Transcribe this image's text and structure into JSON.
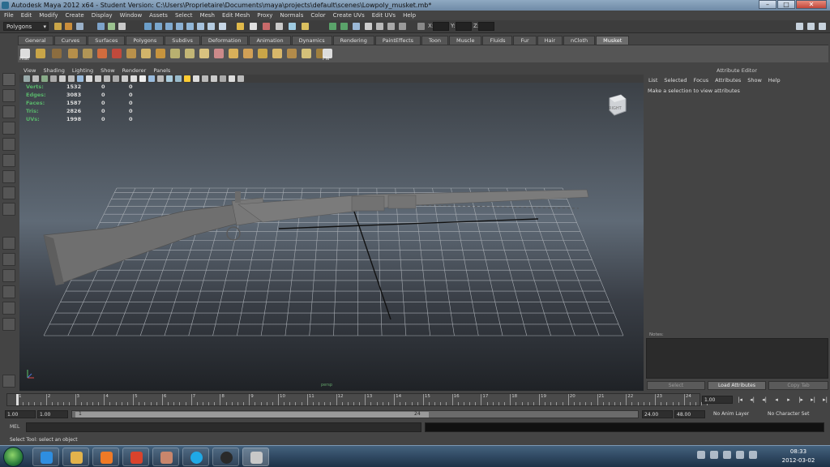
{
  "window": {
    "title": "Autodesk Maya 2012 x64 - Student Version: C:\\Users\\Proprietaire\\Documents\\maya\\projects\\default\\scenes\\Lowpoly_musket.mb*"
  },
  "menubar": [
    "File",
    "Edit",
    "Modify",
    "Create",
    "Display",
    "Window",
    "Assets",
    "Select",
    "Mesh",
    "Edit Mesh",
    "Proxy",
    "Normals",
    "Color",
    "Create UVs",
    "Edit UVs",
    "Help"
  ],
  "statusline": {
    "mode": "Polygons",
    "x_label": "X:",
    "y_label": "Y:",
    "z_label": "Z:"
  },
  "shelf": {
    "tabs": [
      "General",
      "Curves",
      "Surfaces",
      "Polygons",
      "Subdivs",
      "Deformation",
      "Animation",
      "Dynamics",
      "Rendering",
      "PaintEffects",
      "Toon",
      "Muscle",
      "Fluids",
      "Fur",
      "Hair",
      "nCloth",
      "Musket"
    ],
    "active_tab": "Musket",
    "hist_label": "Hist",
    "fn_label": "FN"
  },
  "viewport": {
    "menu": [
      "View",
      "Shading",
      "Lighting",
      "Show",
      "Renderer",
      "Panels"
    ],
    "hud": [
      {
        "label": "Verts:",
        "v1": "1532",
        "v2": "0",
        "v3": "0"
      },
      {
        "label": "Edges:",
        "v1": "3083",
        "v2": "0",
        "v3": "0"
      },
      {
        "label": "Faces:",
        "v1": "1587",
        "v2": "0",
        "v3": "0"
      },
      {
        "label": "Tris:",
        "v1": "2826",
        "v2": "0",
        "v3": "0"
      },
      {
        "label": "UVs:",
        "v1": "1998",
        "v2": "0",
        "v3": "0"
      }
    ],
    "viewcube_label": "RIGHT",
    "camera_label": "persp"
  },
  "attribute_editor": {
    "title": "Attribute Editor",
    "menu": [
      "List",
      "Selected",
      "Focus",
      "Attributes",
      "Show",
      "Help"
    ],
    "message": "Make a selection to view attributes",
    "notes_label": "Notes:",
    "buttons": {
      "select": "Select",
      "load": "Load Attributes",
      "copy": "Copy Tab"
    }
  },
  "timeslider": {
    "ticks": [
      "1",
      "2",
      "3",
      "4",
      "5",
      "6",
      "7",
      "8",
      "9",
      "10",
      "11",
      "12",
      "13",
      "14",
      "15",
      "16",
      "17",
      "18",
      "19",
      "20",
      "21",
      "22",
      "23",
      "24"
    ],
    "current_frame": "1.00"
  },
  "rangeslider": {
    "start": "1.00",
    "start2": "1.00",
    "bar_start": "1",
    "bar_end": "24",
    "end": "24.00",
    "end2": "48.00",
    "anim_layer": "No Anim Layer",
    "char_set": "No Character Set"
  },
  "command": {
    "mel_label": "MEL",
    "help_text": "Select Tool: select an object"
  },
  "taskbar": {
    "time": "08:33",
    "date": "2012-03-02"
  },
  "colors": {
    "hud_label": "#59b66b",
    "viewport_top": "#3c4147",
    "viewport_mid": "#5f6a76"
  }
}
